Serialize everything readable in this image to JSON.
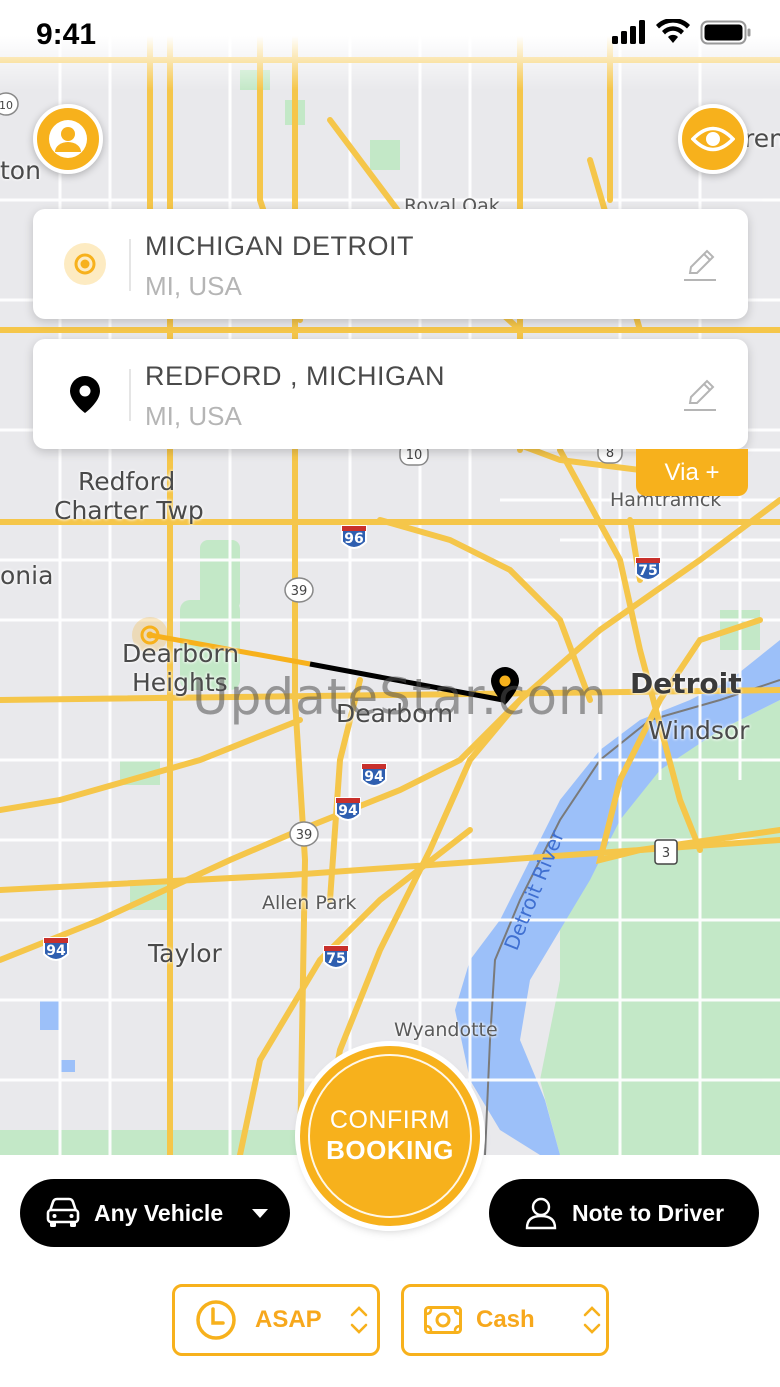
{
  "status_bar": {
    "time": "9:41"
  },
  "colors": {
    "accent": "#f7b11c",
    "dark": "#000000",
    "map_road": "#f5c64a",
    "map_water": "#9cc0f9",
    "map_park": "#c3e8c7"
  },
  "map": {
    "labels": {
      "redford_1": "Redford",
      "redford_2": "Charter Twp",
      "livonia": "onia",
      "dearborn_heights_1": "Dearborn",
      "dearborn_heights_2": "Heights",
      "dearborn": "Dearborn",
      "detroit": "Detroit",
      "windsor": "Windsor",
      "hamtramck": "Hamtramck",
      "royal_oak": "Royal Oak",
      "allen_park": "Allen Park",
      "taylor": "Taylor",
      "wyandotte": "Wyandotte",
      "detroit_river": "Detroit River",
      "ton": "ton",
      "ren": "ren"
    },
    "shields": [
      "96",
      "39",
      "94",
      "94",
      "39",
      "75",
      "94",
      "75",
      "10",
      "8",
      "3",
      "10"
    ],
    "watermark": "UpdateStar.com"
  },
  "pickup": {
    "title": "MICHIGAN DETROIT",
    "subtitle": "MI, USA"
  },
  "dropoff": {
    "title": "REDFORD , MICHIGAN",
    "subtitle": "MI, USA"
  },
  "via_label": "Via +",
  "confirm": {
    "line1": "CONFIRM",
    "line2": "BOOKING"
  },
  "vehicle": {
    "label": "Any Vehicle"
  },
  "note": {
    "label": "Note to Driver"
  },
  "time_option": {
    "label": "ASAP"
  },
  "payment_option": {
    "label": "Cash"
  },
  "icons": [
    "user-icon",
    "eye-icon",
    "pickup-target-icon",
    "location-pin-icon",
    "edit-pencil-icon",
    "car-icon",
    "caret-down-icon",
    "person-outline-icon",
    "clock-icon",
    "cash-icon",
    "up-down-chevron-icon",
    "signal-icon",
    "wifi-icon",
    "battery-icon"
  ]
}
